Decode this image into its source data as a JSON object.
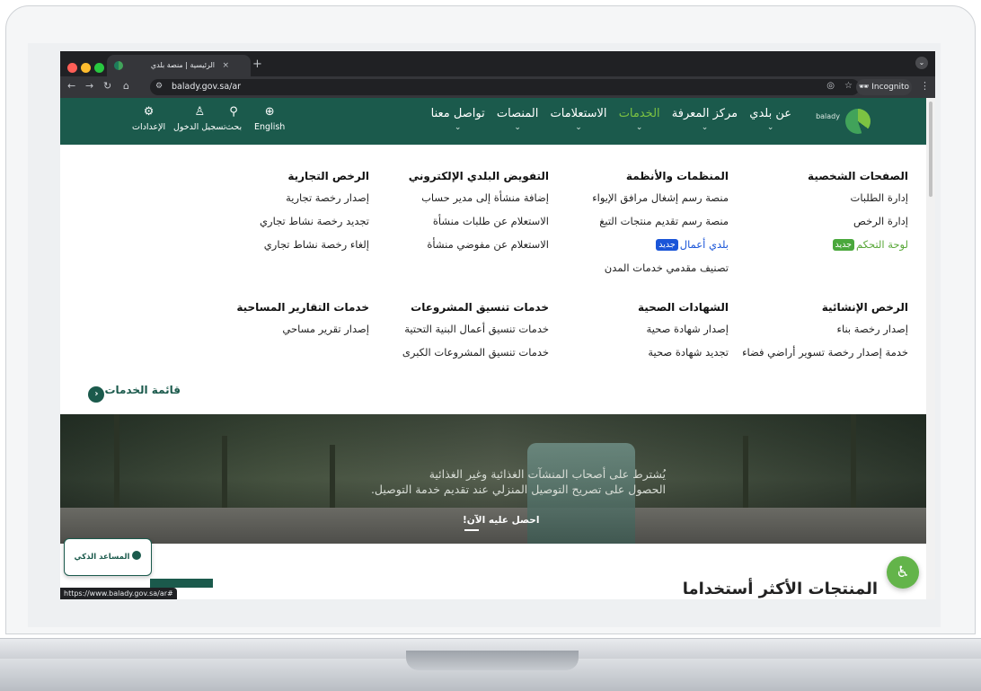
{
  "browser": {
    "tab_title": "الرئيسية | منصة بلدي",
    "tab_close": "×",
    "new_tab": "+",
    "url": "balady.gov.sa/ar",
    "incognito_label": "Incognito",
    "status_url": "https://www.balady.gov.sa/ar#"
  },
  "header": {
    "logo_text": "balady",
    "nav": [
      {
        "label": "عن بلدي"
      },
      {
        "label": "مركز المعرفة"
      },
      {
        "label": "الخدمات",
        "active": true
      },
      {
        "label": "الاستعلامات"
      },
      {
        "label": "المنصات"
      },
      {
        "label": "تواصل معنا"
      }
    ],
    "util": {
      "settings": "الإعدادات",
      "login": "تسجيل الدخول",
      "search": "بحث",
      "language": "English"
    }
  },
  "mega_menu": {
    "personal": {
      "title": "الصفحات الشخصية",
      "links": [
        "إدارة الطلبات",
        "إدارة الرخص"
      ],
      "dashboard": "لوحة التحكم",
      "new_badge": "جديد"
    },
    "orgs": {
      "title": "المنظمات والأنظمة",
      "links": [
        "منصة رسم إشغال مرافق الإيواء",
        "منصة رسم تقديم منتجات التبغ"
      ],
      "balady_business": "بلدي أعمال",
      "new_badge": "جديد",
      "last": "تصنيف مقدمي خدمات المدن"
    },
    "delegation": {
      "title": "التفويض البلدي الإلكتروني",
      "links": [
        "إضافة منشأة إلى مدير حساب",
        "الاستعلام عن طلبات منشأة",
        "الاستعلام عن مفوضي منشأة"
      ]
    },
    "commercial": {
      "title": "الرخص التجارية",
      "links": [
        "إصدار رخصة تجارية",
        "تجديد رخصة نشاط تجاري",
        "إلغاء رخصة نشاط تجاري"
      ]
    },
    "construction": {
      "title": "الرخص الإنشائية",
      "links": [
        "إصدار رخصة بناء",
        "خدمة إصدار رخصة تسوير أراضي فضاء"
      ]
    },
    "health": {
      "title": "الشهادات الصحية",
      "links": [
        "إصدار شهادة صحية",
        "تجديد شهادة صحية"
      ]
    },
    "projects": {
      "title": "خدمات تنسيق المشروعات",
      "links": [
        "خدمات تنسيق أعمال البنية التحتية",
        "خدمات تنسيق المشروعات الكبرى"
      ]
    },
    "survey": {
      "title": "خدمات التقارير المساحية",
      "links": [
        "إصدار تقرير مساحي"
      ]
    },
    "services_list": "قائمة الخدمات"
  },
  "hero": {
    "line1": "يُشترط على أصحاب المنشآت الغذائية وغير الغذائية",
    "line2": "الحصول على تصريح التوصيل المنزلي عند تقديم خدمة التوصيل.",
    "cta": "احصل عليه الآن!"
  },
  "page": {
    "most_used_title": "المنتجات الأكثر أستخداما",
    "assistant_label": "المساعد الذكي"
  },
  "colors": {
    "brand": "#1b5a4c",
    "accent": "#7cc242",
    "badge_green": "#4aa83c",
    "badge_blue": "#1a55d8"
  }
}
